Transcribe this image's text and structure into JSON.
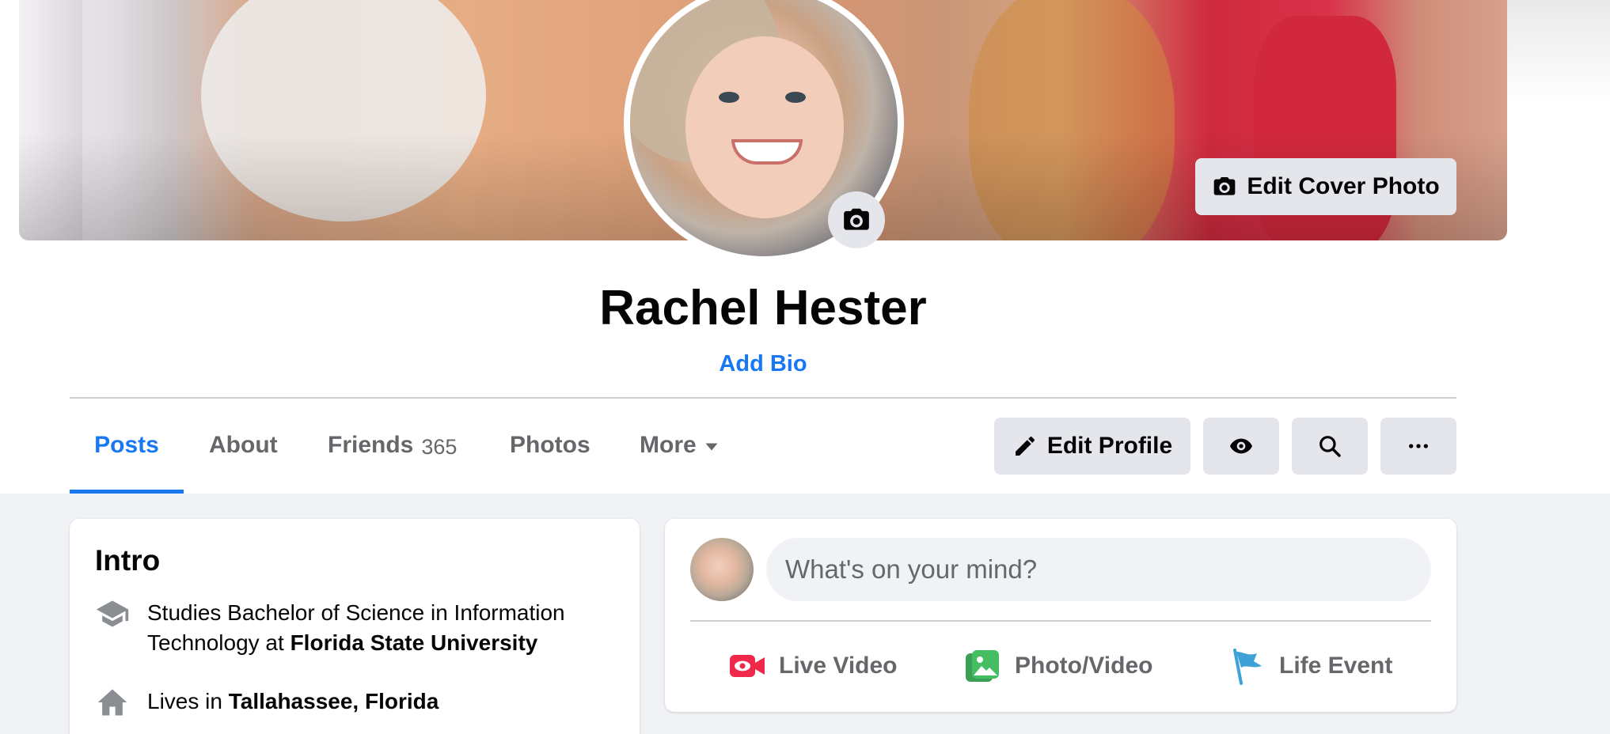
{
  "cover": {
    "edit_label": "Edit Cover Photo"
  },
  "profile": {
    "name": "Rachel Hester",
    "add_bio_label": "Add Bio"
  },
  "tabs": [
    {
      "label": "Posts",
      "active": true
    },
    {
      "label": "About"
    },
    {
      "label": "Friends",
      "count": "365"
    },
    {
      "label": "Photos"
    },
    {
      "label": "More"
    }
  ],
  "actions": {
    "edit_profile_label": "Edit Profile"
  },
  "intro": {
    "title": "Intro",
    "study": {
      "prefix": "Studies Bachelor of Science in Information Technology at ",
      "school": "Florida State University"
    },
    "home": {
      "prefix": "Lives in ",
      "place": "Tallahassee, Florida"
    }
  },
  "composer": {
    "placeholder": "What's on your mind?",
    "actions": [
      {
        "label": "Live Video"
      },
      {
        "label": "Photo/Video"
      },
      {
        "label": "Life Event"
      }
    ]
  },
  "colors": {
    "accent": "#1877f2",
    "button_bg": "#e4e6eb",
    "page_bg": "#f0f2f5",
    "live_red": "#f02849",
    "photo_green": "#45bd62",
    "event_blue": "#3ea2d6"
  }
}
